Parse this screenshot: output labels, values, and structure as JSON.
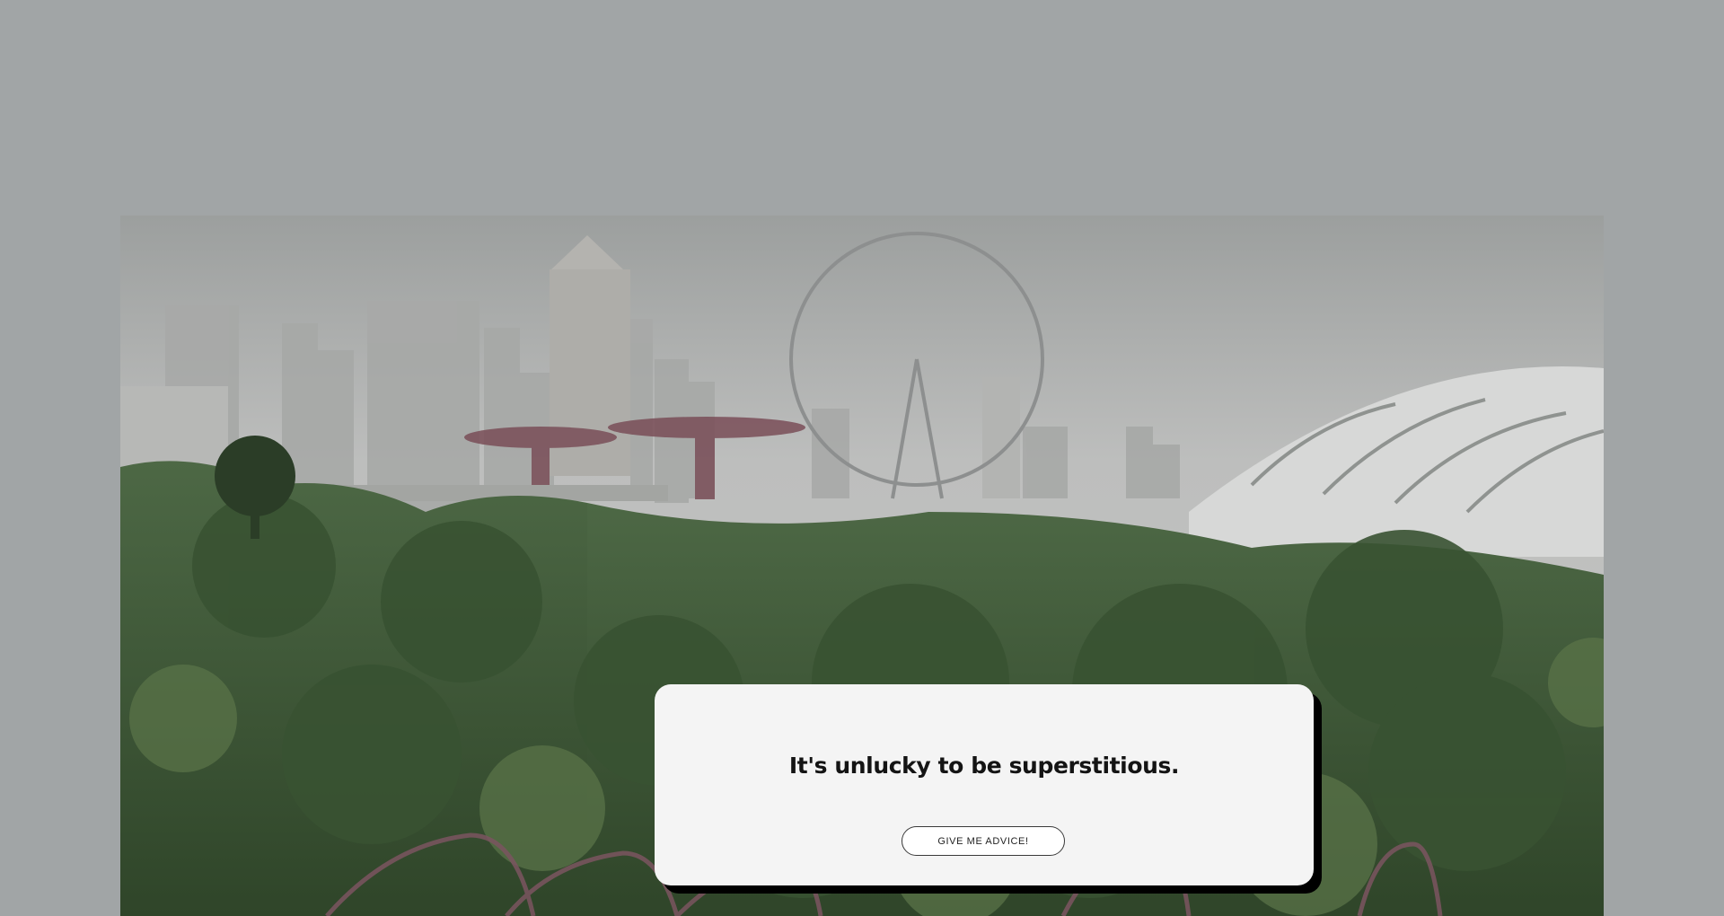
{
  "advice": {
    "quote": "It's unlucky to be superstitious.",
    "button_label": "GIVE ME ADVICE!"
  },
  "background": {
    "description_icon": "city-skyline-photo",
    "colors": {
      "page": "#a1a5a6",
      "sky": "#bfc0bf",
      "foliage": "#3f5a36",
      "card": "#f4f4f4",
      "card_shadow": "#000000"
    }
  }
}
